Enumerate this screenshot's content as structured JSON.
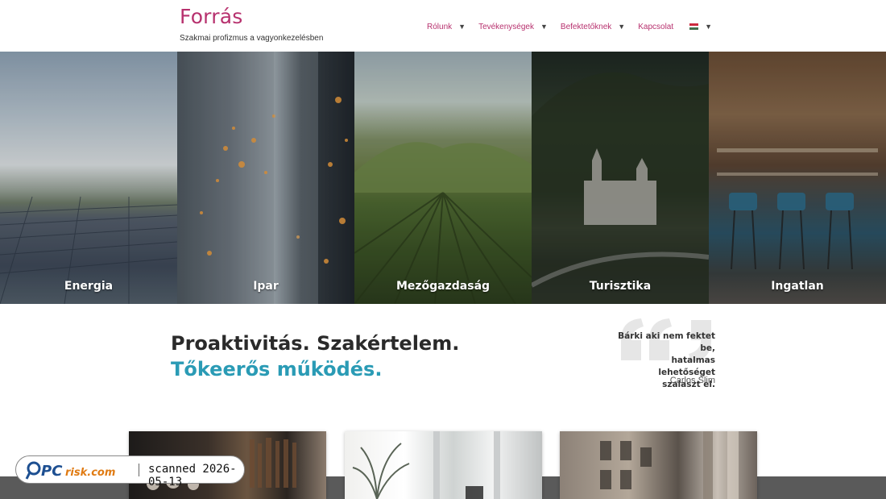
{
  "header": {
    "logo": "Forrás",
    "tagline": "Szakmai profizmus a vagyonkezelésben",
    "nav": [
      {
        "label": "Rólunk"
      },
      {
        "label": "Tevékenységek"
      },
      {
        "label": "Befektetőknek"
      },
      {
        "label": "Kapcsolat"
      }
    ],
    "language_flag": "hungary-flag-icon",
    "colors": {
      "accent": "#b7316e"
    }
  },
  "sectors": [
    {
      "label": "Energia"
    },
    {
      "label": "Ipar"
    },
    {
      "label": "Mezőgazdaság"
    },
    {
      "label": "Turisztika"
    },
    {
      "label": "Ingatlan"
    }
  ],
  "intro": {
    "headline_line1": "Proaktivitás. Szakértelem.",
    "headline_line2": "Tőkeerős működés.",
    "headline_accent_color": "#2a9bb5",
    "quote_line1": "Bárki aki nem fektet be,",
    "quote_line2": "hatalmas lehetőséget",
    "quote_line3": "szalaszt el.",
    "quote_author": "Carlos Slim"
  },
  "watermark": {
    "brand": "PCrisk.com",
    "text": "scanned 2026-05-13"
  }
}
